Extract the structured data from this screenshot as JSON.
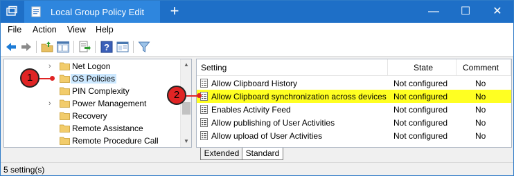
{
  "titlebar": {
    "tab_title": "Local Group Policy Edit",
    "new_tab_symbol": "+",
    "close_tab_symbol": "✕",
    "minimize_symbol": "—",
    "maximize_symbol": "☐",
    "close_symbol": "✕"
  },
  "menu": {
    "items": [
      "File",
      "Action",
      "View",
      "Help"
    ]
  },
  "toolbar": {
    "icons": [
      "back-arrow-icon",
      "forward-arrow-icon",
      "up-folder-icon",
      "show-hide-tree-icon",
      "export-list-icon",
      "help-icon",
      "properties-icon",
      "filter-icon"
    ]
  },
  "tree": {
    "items": [
      {
        "label": "Net Logon",
        "expandable": true
      },
      {
        "label": "OS Policies",
        "expandable": false,
        "selected": true
      },
      {
        "label": "PIN Complexity",
        "expandable": false
      },
      {
        "label": "Power Management",
        "expandable": true
      },
      {
        "label": "Recovery",
        "expandable": false
      },
      {
        "label": "Remote Assistance",
        "expandable": false
      },
      {
        "label": "Remote Procedure Call",
        "expandable": false
      }
    ]
  },
  "list": {
    "headers": {
      "setting": "Setting",
      "state": "State",
      "comment": "Comment"
    },
    "rows": [
      {
        "setting": "Allow Clipboard History",
        "state": "Not configured",
        "comment": "No"
      },
      {
        "setting": "Allow Clipboard synchronization across devices",
        "state": "Not configured",
        "comment": "No",
        "highlighted": true
      },
      {
        "setting": "Enables Activity Feed",
        "state": "Not configured",
        "comment": "No"
      },
      {
        "setting": "Allow publishing of User Activities",
        "state": "Not configured",
        "comment": "No"
      },
      {
        "setting": "Allow upload of User Activities",
        "state": "Not configured",
        "comment": "No"
      }
    ]
  },
  "view_tabs": {
    "extended": "Extended",
    "standard": "Standard"
  },
  "statusbar": {
    "text": "5 setting(s)"
  },
  "annotations": {
    "badge_1": "1",
    "badge_2": "2"
  },
  "colors": {
    "titlebar": "#1e6fc7",
    "highlight_row": "#ffff22",
    "annotation_red": "#e02424",
    "selected_item": "#cce8ff"
  }
}
